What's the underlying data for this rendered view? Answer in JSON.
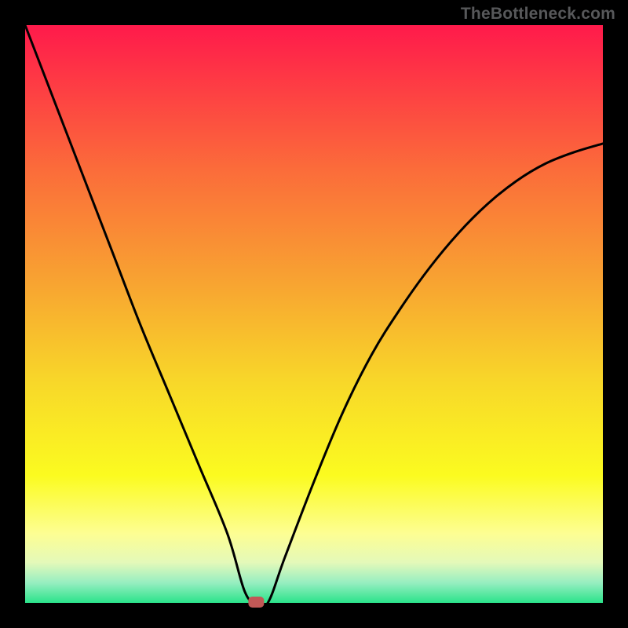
{
  "watermark": "TheBottleneck.com",
  "chart_data": {
    "type": "line",
    "title": "",
    "xlabel": "",
    "ylabel": "",
    "xlim": [
      0,
      100
    ],
    "ylim": [
      0,
      100
    ],
    "x": [
      0,
      5,
      10,
      15,
      20,
      25,
      30,
      35,
      38,
      40,
      42,
      45,
      50,
      55,
      60,
      65,
      70,
      75,
      80,
      85,
      90,
      95,
      100
    ],
    "values": [
      100,
      87,
      74,
      61,
      48,
      36,
      24,
      12,
      2,
      0,
      0,
      8,
      21,
      33,
      43,
      51,
      58,
      64,
      69,
      73,
      76,
      78,
      79.5
    ],
    "min_marker": {
      "x": 40,
      "y": 0
    },
    "background_gradient": {
      "stops": [
        {
          "offset": 0.0,
          "color": "#ff1a4b"
        },
        {
          "offset": 0.25,
          "color": "#fb6c3a"
        },
        {
          "offset": 0.45,
          "color": "#f8a531"
        },
        {
          "offset": 0.62,
          "color": "#f8d829"
        },
        {
          "offset": 0.78,
          "color": "#fbfb20"
        },
        {
          "offset": 0.88,
          "color": "#fdfe93"
        },
        {
          "offset": 0.93,
          "color": "#e4f9b9"
        },
        {
          "offset": 0.965,
          "color": "#97eec1"
        },
        {
          "offset": 1.0,
          "color": "#2be38a"
        }
      ]
    },
    "border_color": "#000000",
    "curve_color": "#000000",
    "marker_color": "#c15856"
  }
}
